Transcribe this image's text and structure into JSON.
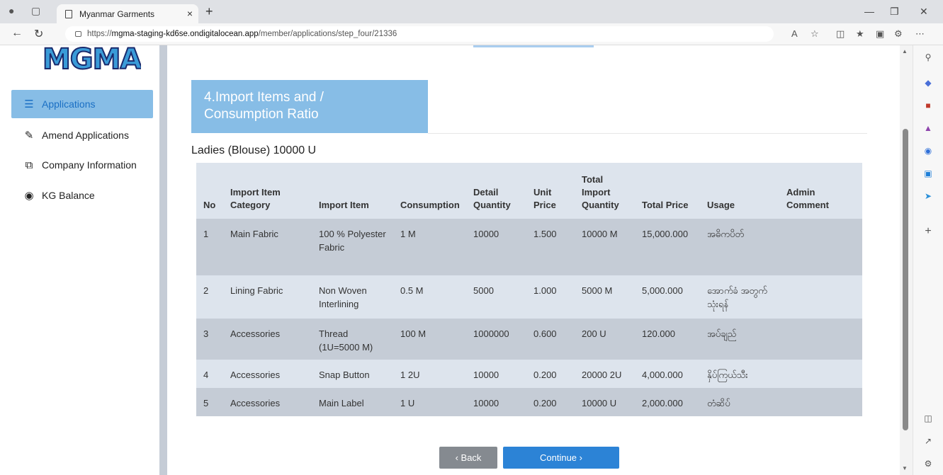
{
  "browser": {
    "tab_title": "Myanmar Garments",
    "tab_close": "×",
    "new_tab": "+",
    "url_prefix": "https://",
    "url_host": "mgma-staging-kd6se.ondigitalocean.app",
    "url_path": "/member/applications/step_four/21336"
  },
  "sidebar": {
    "logo_text": "MGMA",
    "items": [
      {
        "label": "Applications",
        "icon": "list-icon"
      },
      {
        "label": "Amend Applications",
        "icon": "pencil-icon"
      },
      {
        "label": "Company Information",
        "icon": "copy-icon"
      },
      {
        "label": "KG Balance",
        "icon": "balance-icon"
      }
    ]
  },
  "main": {
    "step_title_line1": "4.Import Items and /",
    "step_title_line2": "Consumption Ratio",
    "product_heading": "Ladies (Blouse) 10000 U",
    "table": {
      "headers": [
        "No",
        "Import Item Category",
        "Import Item",
        "Consumption",
        "Detail Quantity",
        "Unit Price",
        "Total Import Quantity",
        "Total Price",
        "Usage",
        "Admin Comment"
      ],
      "rows": [
        [
          "1",
          "Main Fabric",
          "100 % Polyester Fabric",
          "1 M",
          "10000",
          "1.500",
          "10000 M",
          "15,000.000",
          "အဓိကပိတ်",
          ""
        ],
        [
          "2",
          "Lining Fabric",
          "Non Woven Interlining",
          "0.5 M",
          "5000",
          "1.000",
          "5000 M",
          "5,000.000",
          "အောက်ခံ အတွက်သုံးရန်",
          ""
        ],
        [
          "3",
          "Accessories",
          "Thread (1U=5000 M)",
          "100 M",
          "1000000",
          "0.600",
          "200 U",
          "120.000",
          "အပ်ချည်",
          ""
        ],
        [
          "4",
          "Accessories",
          "Snap Button",
          "1 2U",
          "10000",
          "0.200",
          "20000 2U",
          "4,000.000",
          "နှိပ်ကြယ်သီး",
          ""
        ],
        [
          "5",
          "Accessories",
          "Main Label",
          "1 U",
          "10000",
          "0.200",
          "10000 U",
          "2,000.000",
          "တံဆိပ်",
          ""
        ]
      ]
    },
    "buttons": {
      "back": "‹ Back",
      "continue": "Continue ›"
    }
  },
  "colors": {
    "active_sidebar": "#87bde6",
    "step_box": "#87bde6",
    "row_dark": "#c5ccd6",
    "row_light": "#dde4ed",
    "continue_button": "#2c83d6",
    "back_button": "#858a90"
  }
}
